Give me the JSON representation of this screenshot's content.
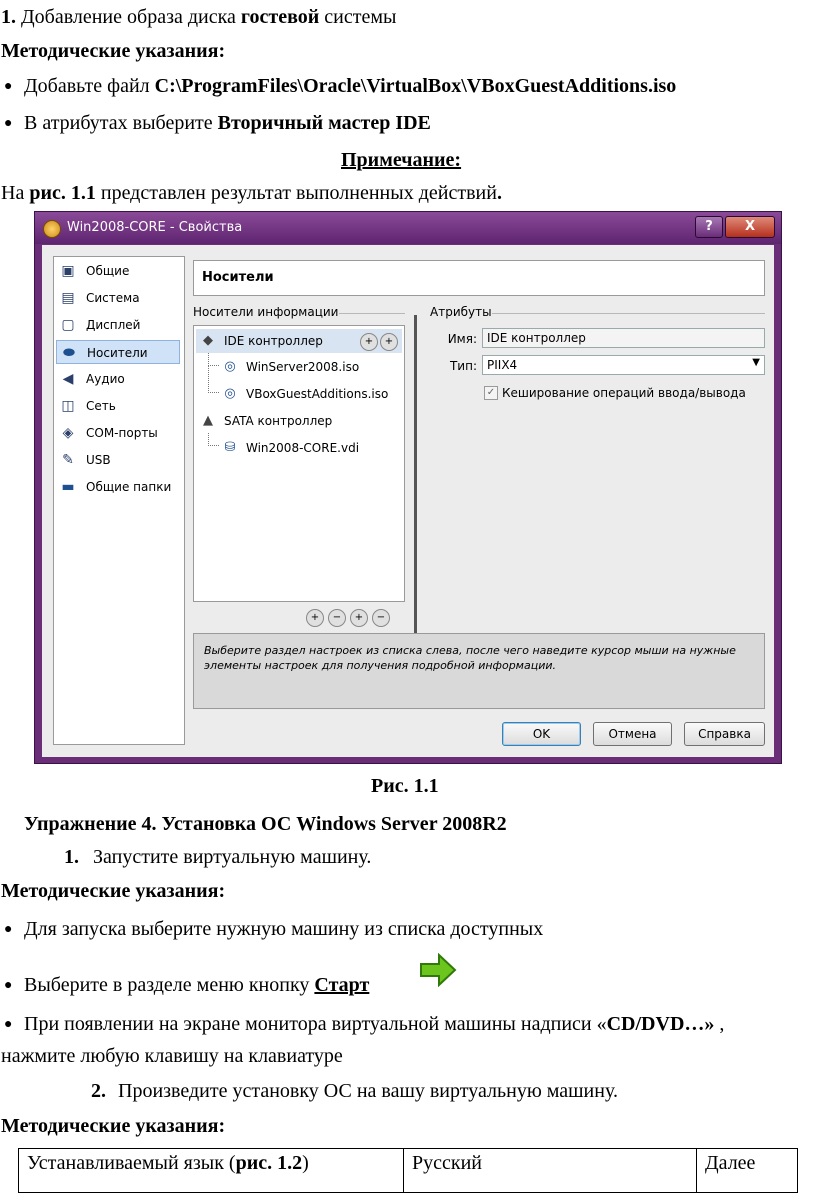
{
  "step1": {
    "num": "1.",
    "pre": " Добавление образа диска ",
    "bold": "гостевой",
    "post": " системы"
  },
  "guidelines1": "Методические указания:",
  "bullet1": {
    "pre": "Добавьте файл ",
    "bold": "C:\\ProgramFiles\\Oracle\\VirtualBox\\VBoxGuestAdditions.iso"
  },
  "bullet2": {
    "pre": "В атрибутах выберите ",
    "bold": "Вторичный мастер IDE"
  },
  "note": "Примечание:",
  "result": {
    "pre": "На ",
    "bold": "рис. 1.1",
    "mid": " представлен результат выполненных действий",
    "end": "."
  },
  "dialog": {
    "title": "Win2008-CORE - Свойства",
    "help_btn": "?",
    "close_btn": "X",
    "sidebar": [
      {
        "label": "Общие",
        "icon": "general-icon"
      },
      {
        "label": "Система",
        "icon": "system-icon"
      },
      {
        "label": "Дисплей",
        "icon": "display-icon"
      },
      {
        "label": "Носители",
        "icon": "storage-icon"
      },
      {
        "label": "Аудио",
        "icon": "audio-icon"
      },
      {
        "label": "Сеть",
        "icon": "network-icon"
      },
      {
        "label": "COM-порты",
        "icon": "com-ports-icon"
      },
      {
        "label": "USB",
        "icon": "usb-icon"
      },
      {
        "label": "Общие папки",
        "icon": "shared-folders-icon"
      }
    ],
    "section_title": "Носители",
    "storage_group": "Носители информации",
    "attributes_group": "Атрибуты",
    "tree": [
      {
        "label": "IDE контроллер",
        "level": 0,
        "icon": "ide-controller-icon"
      },
      {
        "label": "WinServer2008.iso",
        "level": 1,
        "icon": "cd-icon"
      },
      {
        "label": "VBoxGuestAdditions.iso",
        "level": 1,
        "icon": "cd-icon"
      },
      {
        "label": "SATA контроллер",
        "level": 0,
        "icon": "sata-controller-icon"
      },
      {
        "label": "Win2008-CORE.vdi",
        "level": 1,
        "icon": "hdd-icon"
      }
    ],
    "name_label": "Имя:",
    "name_value": "IDE контроллер",
    "type_label": "Тип:",
    "type_value": "PIIX4",
    "cache_label": "Кеширование операций ввода/вывода",
    "info": "Выберите раздел настроек из списка слева, после чего наведите курсор мыши на нужные элементы настроек для получения подробной информации.",
    "ok": "OK",
    "cancel": "Отмена",
    "help": "Справка"
  },
  "caption": "Рис. 1.1",
  "exercise": "Упражнение 4. Установка ОС Windows Server 2008R2",
  "step_a": {
    "num": "1.",
    "text": "Запустите виртуальную машину."
  },
  "guidelines2": "Методические указания:",
  "bullet3": "Для запуска выберите нужную машину из списка доступных",
  "bullet4": {
    "pre": "Выберите в разделе меню кнопку ",
    "bold": "Старт"
  },
  "bullet5": {
    "pre": "При появлении на экране монитора виртуальной машины надписи «",
    "bold": "CD/DVD…»",
    "post": " ,"
  },
  "bullet5_cont": "нажмите любую клавишу на клавиатуре",
  "step_b": {
    "num": "2.",
    "text": "Произведите установку ОС на вашу виртуальную машину."
  },
  "guidelines3": "Методические указания:",
  "table": {
    "c1_pre": "Устанавливаемый язык (",
    "c1_bold": "рис. 1.2",
    "c1_post": ")",
    "c2": "Русский",
    "c3": "Далее"
  }
}
